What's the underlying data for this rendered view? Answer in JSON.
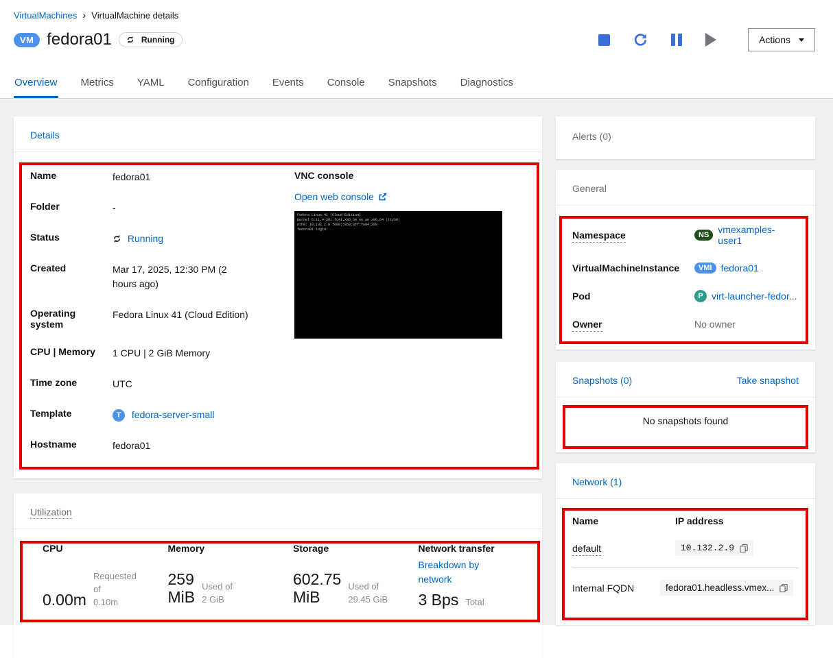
{
  "colors": {
    "link_blue": "#0066cc",
    "action_icon_blue": "#3c6eda",
    "annotation_red": "#e00000",
    "vm_badge_blue": "#4d92ea",
    "namespace_badge_green": "#1e4f18",
    "pod_badge_teal": "#2a9d8f",
    "background_gray": "#f0f0f0"
  },
  "breadcrumb": {
    "link": "VirtualMachines",
    "separator": "›",
    "current": "VirtualMachine details"
  },
  "header": {
    "resource_badge": "VM",
    "title": "fedora01",
    "status": "Running",
    "actions_label": "Actions"
  },
  "tabs": [
    {
      "label": "Overview",
      "active": true
    },
    {
      "label": "Metrics",
      "active": false
    },
    {
      "label": "YAML",
      "active": false
    },
    {
      "label": "Configuration",
      "active": false
    },
    {
      "label": "Events",
      "active": false
    },
    {
      "label": "Console",
      "active": false
    },
    {
      "label": "Snapshots",
      "active": false
    },
    {
      "label": "Diagnostics",
      "active": false
    }
  ],
  "details": {
    "title": "Details",
    "rows": [
      {
        "label": "Name",
        "value": "fedora01"
      },
      {
        "label": "Folder",
        "value": "-"
      },
      {
        "label": "Status",
        "value": "Running"
      },
      {
        "label": "Created",
        "value": "Mar 17, 2025, 12:30 PM (2 hours ago)"
      },
      {
        "label": "Operating system",
        "value": "Fedora Linux 41 (Cloud Edition)"
      },
      {
        "label": "CPU | Memory",
        "value": "1 CPU | 2 GiB Memory"
      },
      {
        "label": "Time zone",
        "value": "UTC"
      },
      {
        "label": "Template",
        "value": "fedora-server-small",
        "badge": "T"
      },
      {
        "label": "Hostname",
        "value": "fedora01"
      }
    ],
    "vnc": {
      "heading": "VNC console",
      "open_link": "Open web console",
      "console_lines": [
        "Fedora Linux 41 (Cloud Edition)",
        "Kernel 6.11.4-301.fc41.x86_64 on an x86_64 (ttyS0)",
        "",
        "eth0: 10.132.2.9 fe80::858:aff:fe84:209",
        "fedora01 login:"
      ]
    }
  },
  "utilization": {
    "title": "Utilization",
    "cpu": {
      "label": "CPU",
      "value": "0.00m",
      "caption_line1": "Requested",
      "caption_line2": "of",
      "total": "0.10m"
    },
    "memory": {
      "label": "Memory",
      "value_num": "259",
      "value_unit": "MiB",
      "caption": "Used of",
      "total": "2 GiB"
    },
    "storage": {
      "label": "Storage",
      "value_num": "602.75",
      "value_unit": "MiB",
      "caption": "Used of",
      "total": "29.45 GiB"
    },
    "network_transfer": {
      "label": "Network transfer",
      "link_line1": "Breakdown by",
      "link_line2": "network",
      "value": "3 Bps",
      "caption": "Total"
    }
  },
  "alerts": {
    "title": "Alerts (0)"
  },
  "general": {
    "title": "General",
    "rows": [
      {
        "label": "Namespace",
        "badge": "NS",
        "value": "vmexamples-user1"
      },
      {
        "label": "VirtualMachineInstance",
        "badge": "VMI",
        "value": "fedora01"
      },
      {
        "label": "Pod",
        "badge": "P",
        "value": "virt-launcher-fedor..."
      },
      {
        "label": "Owner",
        "value": "No owner"
      }
    ]
  },
  "snapshots": {
    "title": "Snapshots (0)",
    "action": "Take snapshot",
    "empty": "No snapshots found"
  },
  "network": {
    "title": "Network (1)",
    "headers": {
      "name": "Name",
      "ip": "IP address"
    },
    "rows": [
      {
        "name": "default",
        "value": "10.132.2.9"
      },
      {
        "name": "Internal FQDN",
        "value": "fedora01.headless.vmex..."
      }
    ]
  }
}
